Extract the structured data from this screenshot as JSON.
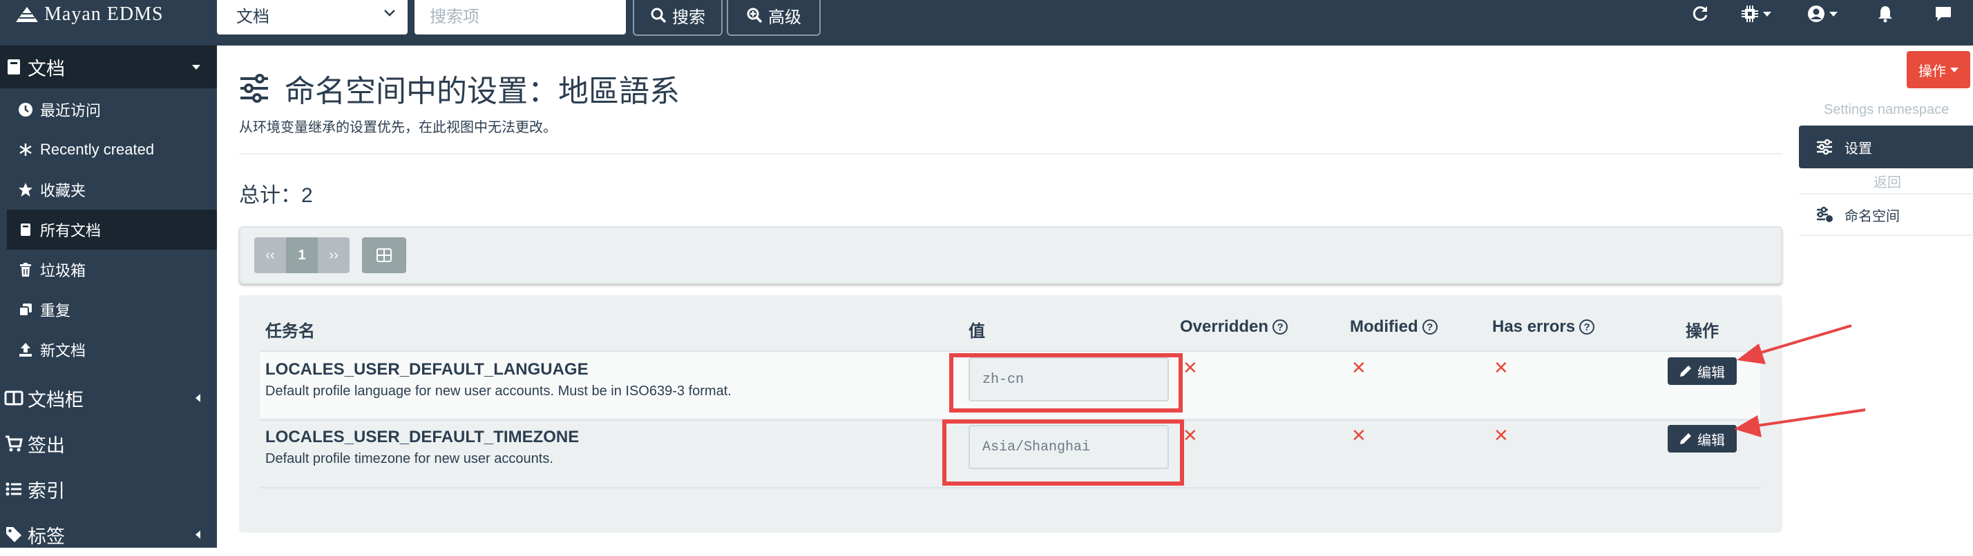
{
  "topbar": {
    "brand": "Mayan EDMS",
    "search_type": "文档",
    "search_placeholder": "搜索项",
    "search_button": "搜索",
    "advanced_button": "高级"
  },
  "sidebar": {
    "documents": "文档",
    "items": [
      {
        "label": "最近访问",
        "icon": "clock-icon"
      },
      {
        "label": "Recently created",
        "icon": "asterisk-icon"
      },
      {
        "label": "收藏夹",
        "icon": "star-icon"
      },
      {
        "label": "所有文档",
        "icon": "book-icon"
      },
      {
        "label": "垃圾箱",
        "icon": "trash-icon"
      },
      {
        "label": "重复",
        "icon": "clone-icon"
      },
      {
        "label": "新文档",
        "icon": "upload-icon"
      }
    ],
    "cabinets": "文档柜",
    "checkouts": "签出",
    "indexes": "索引",
    "tags": "标签"
  },
  "page": {
    "title": "命名空间中的设置：地區語系",
    "description": "从环境变量继承的设置优先，在此视图中无法更改。",
    "total": "总计：2"
  },
  "pagination": {
    "prev": "‹‹",
    "current": "1",
    "next": "››"
  },
  "table": {
    "headers": {
      "name": "任务名",
      "value": "值",
      "overridden": "Overridden",
      "modified": "Modified",
      "has_errors": "Has errors",
      "actions": "操作"
    },
    "rows": [
      {
        "name": "LOCALES_USER_DEFAULT_LANGUAGE",
        "description": "Default profile language for new user accounts. Must be in ISO639-3 format.",
        "value": "zh-cn",
        "overridden": "✕",
        "modified": "✕",
        "has_errors": "✕",
        "edit": "编辑"
      },
      {
        "name": "LOCALES_USER_DEFAULT_TIMEZONE",
        "description": "Default profile timezone for new user accounts.",
        "value": "Asia/Shanghai",
        "overridden": "✕",
        "modified": "✕",
        "has_errors": "✕",
        "edit": "编辑"
      }
    ]
  },
  "right_panel": {
    "actions_button": "操作",
    "namespace_heading": "Settings namespace",
    "settings_button": "设置",
    "back_heading": "返回",
    "namespaces_button": "命名空间"
  },
  "colors": {
    "navbar": "#2c3e50",
    "accent_red": "#e74c3c",
    "annotation_red": "#e84545",
    "panel_bg": "#ecf0f1"
  }
}
